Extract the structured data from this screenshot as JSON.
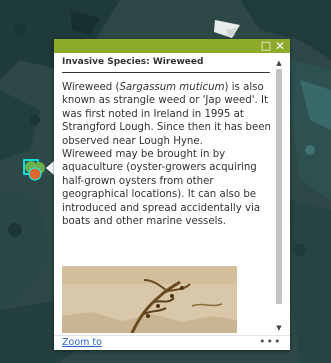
{
  "popup": {
    "title": "Invasive Species: Wireweed",
    "header_color": "#8eaa2a",
    "icons": {
      "maximize": "maximize-icon",
      "close": "close-icon"
    },
    "maximize_glyph": "□",
    "close_glyph": "✕",
    "body": {
      "p1_pre": "Wireweed (",
      "p1_em": "Sargassum muticum",
      "p1_post": ") is also known as strangle weed or 'Jap weed'. It was first noted in Ireland in 1995 at Strangford Lough. Since then it has been observed near Lough Hyne.",
      "p2": "Wireweed may be brought in by aquaculture (oyster-growers acquiring half-grown oysters from other geographical locations). It can also be introduced and spread accidentally via boats and other marine vessels."
    },
    "scrollbar": {
      "up_glyph": "▲",
      "down_glyph": "▼",
      "position_fraction": 0,
      "visible_fraction": 0.93
    },
    "footer": {
      "zoom_label": "Zoom to",
      "more_glyph": "•••"
    }
  },
  "map": {
    "water_color": "#2f4a4a",
    "marker_color": "#6ab04c",
    "marker_highlight": "#00ffff"
  }
}
